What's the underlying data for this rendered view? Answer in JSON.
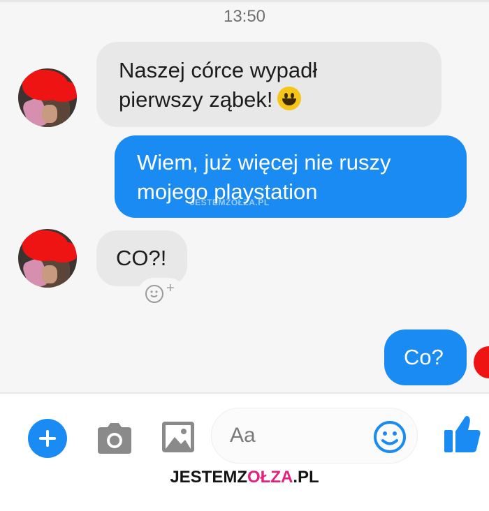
{
  "status": {
    "time": "13:50"
  },
  "messages": [
    {
      "from": "other",
      "lines": [
        "Naszej córce wypadł",
        "pierwszy ząbek!"
      ],
      "emoji": "grinning-face-emoji"
    },
    {
      "from": "me",
      "lines": [
        "Wiem, już więcej nie ruszy",
        "mojego playstation"
      ]
    },
    {
      "from": "other",
      "lines": [
        "CO?!"
      ]
    },
    {
      "from": "me",
      "lines": [
        "Co?"
      ]
    }
  ],
  "composer": {
    "placeholder": "Aa"
  },
  "watermark": {
    "part1": "JESTEMZ",
    "part2": "OŁZA",
    "part3": ".PL",
    "inline": "JESTEMZOŁZA.PL"
  },
  "colors": {
    "outgoing": "#1a8bf3",
    "incoming": "#e8e8e8",
    "accent": "#e6207d",
    "redact": "#ef1414"
  },
  "icons": [
    "plus-icon",
    "camera-icon",
    "image-icon",
    "smiley-icon",
    "thumbs-up-icon",
    "add-reaction-icon"
  ]
}
